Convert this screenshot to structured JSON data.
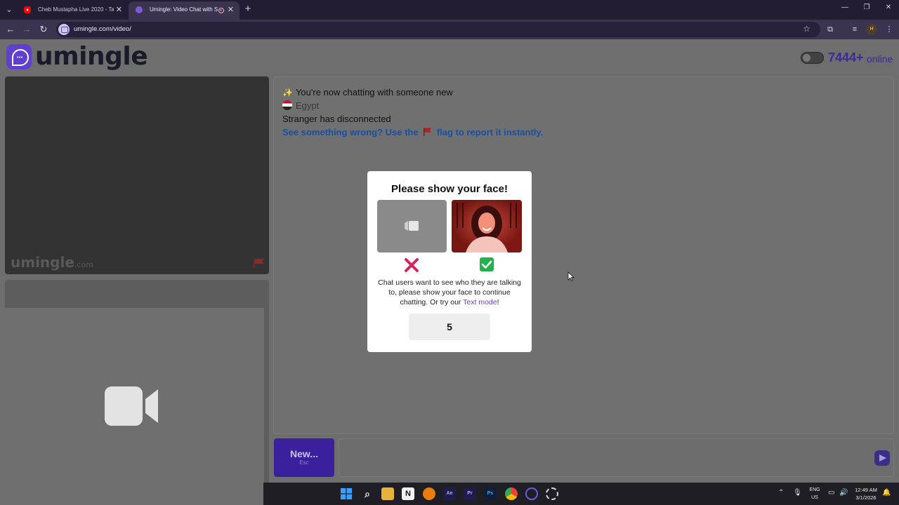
{
  "browser": {
    "tabs": [
      {
        "title": "Cheb Mustapha Live 2020 - Tay"
      },
      {
        "title": "Umingle: Video Chat with S"
      }
    ],
    "url": "umingle.com/video/",
    "profile_initial": "H"
  },
  "header": {
    "logo_text": "umingle",
    "online_count": "7444+",
    "online_label": "online"
  },
  "stranger_video": {
    "watermark": "umingle",
    "watermark_suffix": ".com"
  },
  "chat": {
    "messages": [
      {
        "text": "You're now chatting with someone new",
        "icon": "sparkles-icon"
      },
      {
        "text": "Egypt",
        "icon": "egypt-flag-icon"
      },
      {
        "text": "Stranger has disconnected"
      },
      {
        "text_before": "See something wrong? Use the",
        "text_after": "flag to report it instantly.",
        "icon": "red-flag-icon"
      }
    ],
    "new_button": {
      "label": "New...",
      "shortcut": "Esc"
    }
  },
  "modal": {
    "title": "Please show your face!",
    "body_before": "Chat users want to see who they are talking to, please show your face to continue chatting. Or try our",
    "link_text": "Text mode",
    "body_after": "!",
    "countdown": "5"
  },
  "taskbar": {
    "lang_top": "ENG",
    "lang_bottom": "US",
    "time": "12:49 AM",
    "date": "3/1/2026"
  },
  "colors": {
    "brand": "#5e3fcf",
    "online": "#3b2a9c",
    "report_link": "#1b4f9e",
    "check": "#23b14d",
    "cross": "#d6245a"
  }
}
